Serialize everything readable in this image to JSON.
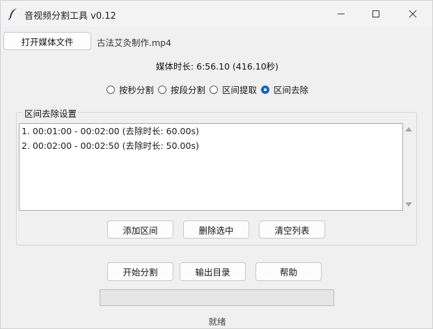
{
  "window": {
    "title": "音视频分割工具 v0.12",
    "icon": "feather-icon"
  },
  "toolbar": {
    "open_label": "打开媒体文件",
    "filename": "古法艾灸制作.mp4"
  },
  "media": {
    "duration_text": "媒体时长: 6:56.10 (416.10秒)"
  },
  "modes": [
    {
      "label": "按秒分割",
      "checked": false
    },
    {
      "label": "按段分割",
      "checked": false
    },
    {
      "label": "区间提取",
      "checked": false
    },
    {
      "label": "区间去除",
      "checked": true
    }
  ],
  "range_group": {
    "title": "区间去除设置",
    "items": [
      "1. 00:01:00 - 00:02:00 (去除时长: 60.00s)",
      "2. 00:02:00 - 00:02:50 (去除时长: 50.00s)"
    ],
    "add_label": "添加区间",
    "delete_label": "删除选中",
    "clear_label": "清空列表"
  },
  "actions": {
    "start_label": "开始分割",
    "outdir_label": "输出目录",
    "help_label": "帮助"
  },
  "progress": {
    "value": 0
  },
  "status": {
    "text": "就绪"
  },
  "colors": {
    "accent": "#1565c0",
    "progress_fill": "#06b025"
  }
}
